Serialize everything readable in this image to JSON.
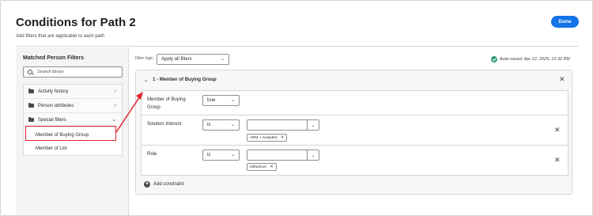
{
  "dialog": {
    "title": "Conditions for Path 2",
    "subtitle": "Add filters that are applicable to each path",
    "done_label": "Done"
  },
  "library": {
    "title": "Matched Person Filters",
    "search_placeholder": "Search library",
    "folders": [
      {
        "label": "Activity history",
        "chevron": "›"
      },
      {
        "label": "Person attributes",
        "chevron": "›"
      },
      {
        "label": "Special filters",
        "chevron": "⌄"
      }
    ],
    "special_filters_items": [
      "Member of Buying Group",
      "Member of List"
    ]
  },
  "filters": {
    "logic_label": "Filter logic",
    "logic_value": "Apply all filters",
    "autosave_text": "Auto-saved: Apr 22, 2025, 12:32 PM"
  },
  "group": {
    "title": "1 - Member of Buying Group",
    "conditions": [
      {
        "label": "Member of Buying Group",
        "operator": "true"
      },
      {
        "label": "Solution Interest",
        "operator": "is",
        "value": "",
        "tag": "AEM + Analytics"
      },
      {
        "label": "Role",
        "operator": "is",
        "value": "",
        "tag": "Influencer"
      }
    ],
    "add_constraint_label": "Add constraint"
  },
  "glyphs": {
    "chevron_down": "⌄",
    "chevron_right": "›",
    "close": "✕",
    "tag_remove": "✕",
    "plus": "+"
  },
  "colors": {
    "accent": "#1473e6",
    "highlight": "#e0262d",
    "success": "#2d9d78"
  }
}
